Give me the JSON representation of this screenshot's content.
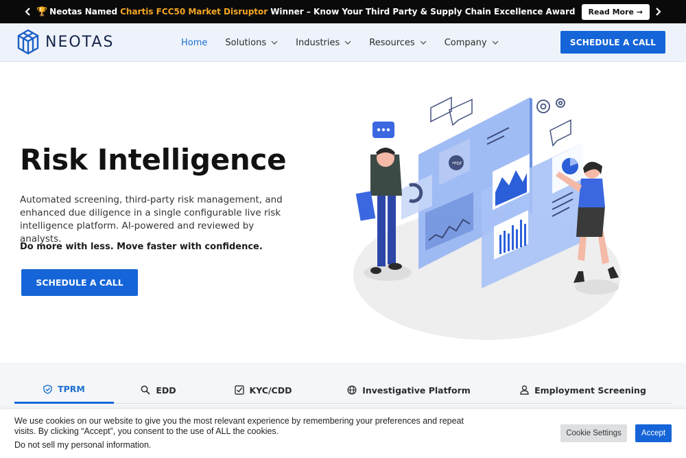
{
  "announcement": {
    "prefix": "Neotas Named",
    "highlight": "Chartis FCC50 Market Disruptor",
    "suffix": "Winner – Know Your Third Party & Supply Chain Excellence Award",
    "button": "Read More →",
    "icon": "trophy-icon"
  },
  "header": {
    "logo_text": "NEOTAS",
    "nav": [
      {
        "label": "Home",
        "active": true
      },
      {
        "label": "Solutions"
      },
      {
        "label": "Industries"
      },
      {
        "label": "Resources"
      },
      {
        "label": "Company"
      }
    ],
    "cta": "SCHEDULE A CALL"
  },
  "hero": {
    "title": "Risk Intelligence",
    "description": "Automated screening, third-party risk management, and enhanced due diligence in a single configurable live risk intelligence platform. AI-powered and reviewed by analysts.",
    "strong": "Do more with less. Move faster with confidence.",
    "cta": "SCHEDULE A CALL",
    "illustration_text": "*PDF"
  },
  "tabs": [
    {
      "label": "TPRM",
      "icon": "shield-check-icon",
      "active": true
    },
    {
      "label": "EDD",
      "icon": "search-icon"
    },
    {
      "label": "KYC/CDD",
      "icon": "checkbox-icon"
    },
    {
      "label": "Investigative Platform",
      "icon": "globe-icon"
    },
    {
      "label": "Employment Screening",
      "icon": "user-icon"
    }
  ],
  "cookie": {
    "text": "We use cookies on our website to give you the most relevant experience by remembering your preferences and repeat visits. By clicking “Accept”, you consent to the use of ALL the cookies.",
    "link": "Do not sell my personal information.",
    "settings": "Cookie Settings",
    "accept": "Accept"
  },
  "colors": {
    "brand_blue": "#1565d8",
    "topbar_bg": "#0a0a0a",
    "highlight": "#f5a623",
    "header_bg": "#eef3fb"
  }
}
